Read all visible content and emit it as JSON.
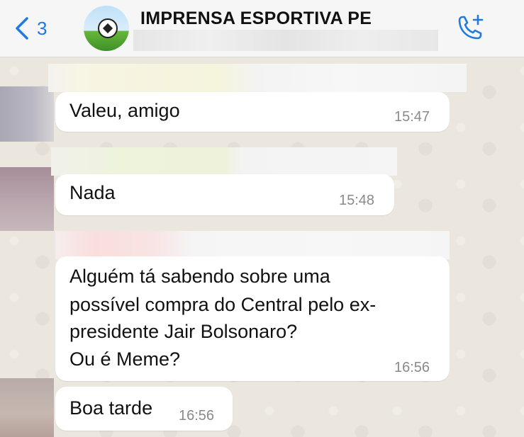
{
  "header": {
    "back_count": "3",
    "group_name": "IMPRENSA ESPORTIVA PE"
  },
  "messages": [
    {
      "text": "Valeu, amigo",
      "time": "15:47"
    },
    {
      "text": "Nada",
      "time": "15:48"
    },
    {
      "text_lines": [
        "Alguém tá sabendo sobre uma",
        "possível compra do Central pelo ex-",
        "presidente Jair Bolsonaro?",
        "Ou é Meme?"
      ],
      "time": "16:56"
    },
    {
      "text": "Boa tarde",
      "time": "16:56"
    }
  ],
  "colors": {
    "accent": "#1f7ae0",
    "bubble": "#ffffff",
    "chat_background": "#ebe6de"
  },
  "icons": [
    "chevron-left-icon",
    "add-call-icon",
    "group-avatar"
  ]
}
